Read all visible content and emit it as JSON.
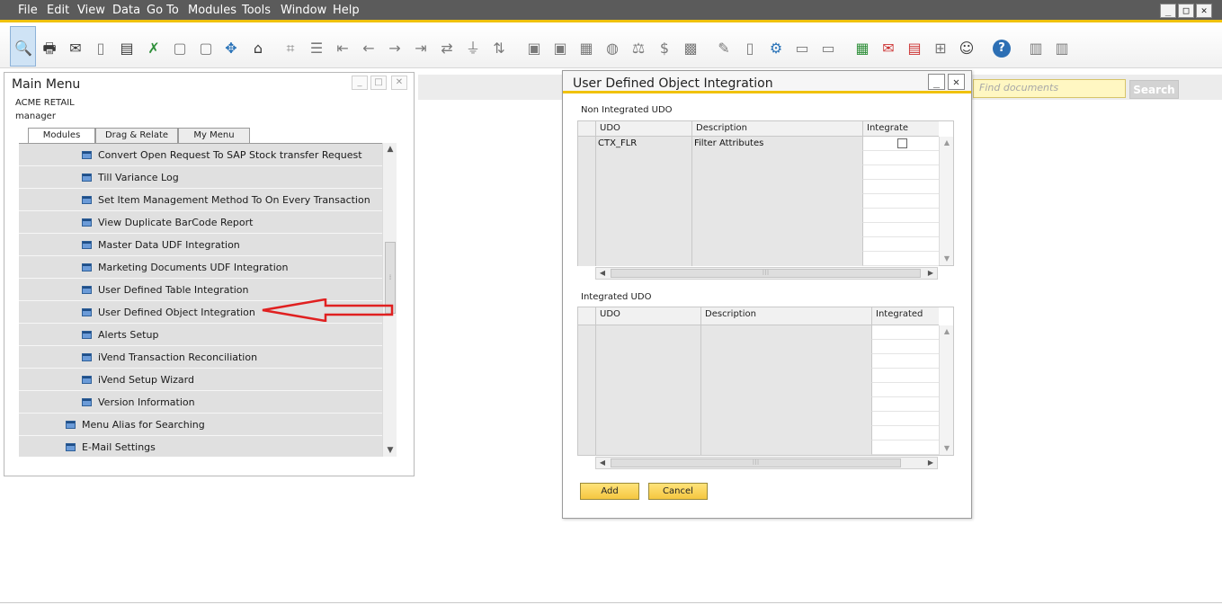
{
  "menubar": {
    "items": [
      "File",
      "Edit",
      "View",
      "Data",
      "Go To",
      "Modules",
      "Tools",
      "Window",
      "Help"
    ],
    "window_controls": [
      "_",
      "□",
      "✕"
    ]
  },
  "toolbar": {
    "icons": [
      "preview-icon",
      "print-icon",
      "email-icon",
      "sms-icon",
      "fax-icon",
      "excel-icon",
      "word-icon",
      "pdf-icon",
      "launch-icon",
      "lock-icon",
      "find-icon",
      "add-icon",
      "first-record-icon",
      "previous-record-icon",
      "next-record-icon",
      "last-record-icon",
      "refresh-icon",
      "filter-icon",
      "sort-icon",
      "base-document-icon",
      "target-document-icon",
      "gross-profit-icon",
      "payment-icon",
      "volume-weight-icon",
      "currency-icon",
      "journal-icon",
      "form-settings-icon",
      "edit-icon",
      "new-doc-icon",
      "settings-icon",
      "messages-icon",
      "alerts-icon",
      "calendar-icon",
      "cancel-icon",
      "reports-icon",
      "org-chart-icon",
      "user-icon",
      "help-icon",
      "server-icon",
      "server2-icon"
    ],
    "help_glyph": "?"
  },
  "search": {
    "placeholder": "Find documents",
    "button_label": "Search"
  },
  "main_menu": {
    "title": "Main Menu",
    "company": "ACME RETAIL",
    "user": "manager",
    "tabs": [
      "Modules",
      "Drag & Relate",
      "My Menu"
    ],
    "active_tab": "Modules",
    "items": [
      {
        "label": "Convert Open Request To SAP Stock transfer Request",
        "indent": 2
      },
      {
        "label": "Till Variance Log",
        "indent": 2
      },
      {
        "label": "Set Item Management Method To On Every Transaction",
        "indent": 2
      },
      {
        "label": "View Duplicate BarCode Report",
        "indent": 2
      },
      {
        "label": "Master Data UDF Integration",
        "indent": 2
      },
      {
        "label": "Marketing Documents UDF Integration",
        "indent": 2
      },
      {
        "label": "User Defined Table Integration",
        "indent": 2
      },
      {
        "label": "User Defined Object Integration",
        "indent": 2
      },
      {
        "label": "Alerts Setup",
        "indent": 2
      },
      {
        "label": "iVend Transaction Reconciliation",
        "indent": 2
      },
      {
        "label": "iVend Setup Wizard",
        "indent": 2
      },
      {
        "label": "Version Information",
        "indent": 2
      },
      {
        "label": "Menu Alias for Searching",
        "indent": 1
      },
      {
        "label": "E-Mail Settings",
        "indent": 1
      }
    ],
    "highlight_color": "#e02020"
  },
  "udo_dialog": {
    "title": "User Defined Object Integration",
    "non_integrated": {
      "label": "Non Integrated UDO",
      "columns": [
        "UDO",
        "Description",
        "Integrate"
      ],
      "rows": [
        {
          "udo": "CTX_FLR",
          "description": "Filter Attributes",
          "integrate": false
        }
      ],
      "empty_rows": 8
    },
    "integrated": {
      "label": "Integrated UDO",
      "columns": [
        "UDO",
        "Description",
        "Integrated"
      ],
      "rows": [],
      "empty_rows": 9
    },
    "buttons": {
      "add": "Add",
      "cancel": "Cancel"
    }
  },
  "colors": {
    "menubar_bg": "#5b5b5b",
    "accent_yellow": "#f0c20c",
    "button_yellow": "#f5c740",
    "arrow_red": "#e02020"
  }
}
